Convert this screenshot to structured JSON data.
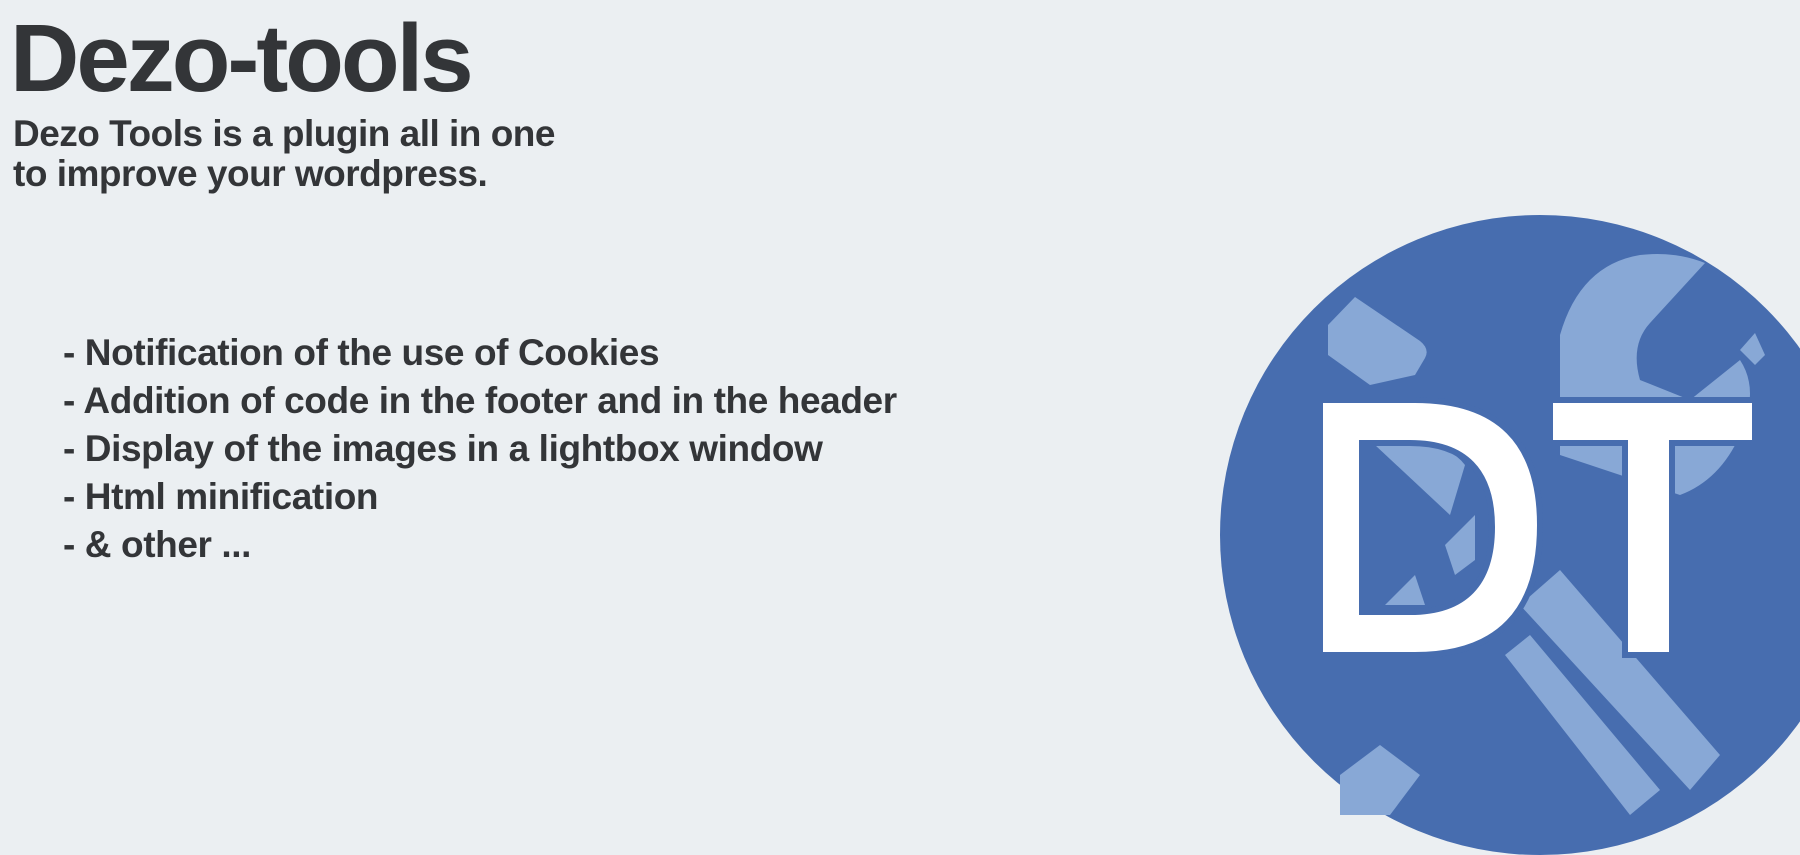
{
  "header": {
    "title": "Dezo-tools",
    "subtitle_lines": [
      "Dezo Tools is a plugin all in one",
      "to improve your wordpress."
    ]
  },
  "features": [
    "- Notification of the use of Cookies",
    "- Addition of code in the footer and in the header",
    "- Display of the images in a lightbox window",
    "- Html minification",
    "- & other ..."
  ],
  "logo": {
    "text": "DT",
    "circle_color": "#476daf",
    "tools_color": "#88a8d6",
    "letter_color": "#ffffff"
  }
}
